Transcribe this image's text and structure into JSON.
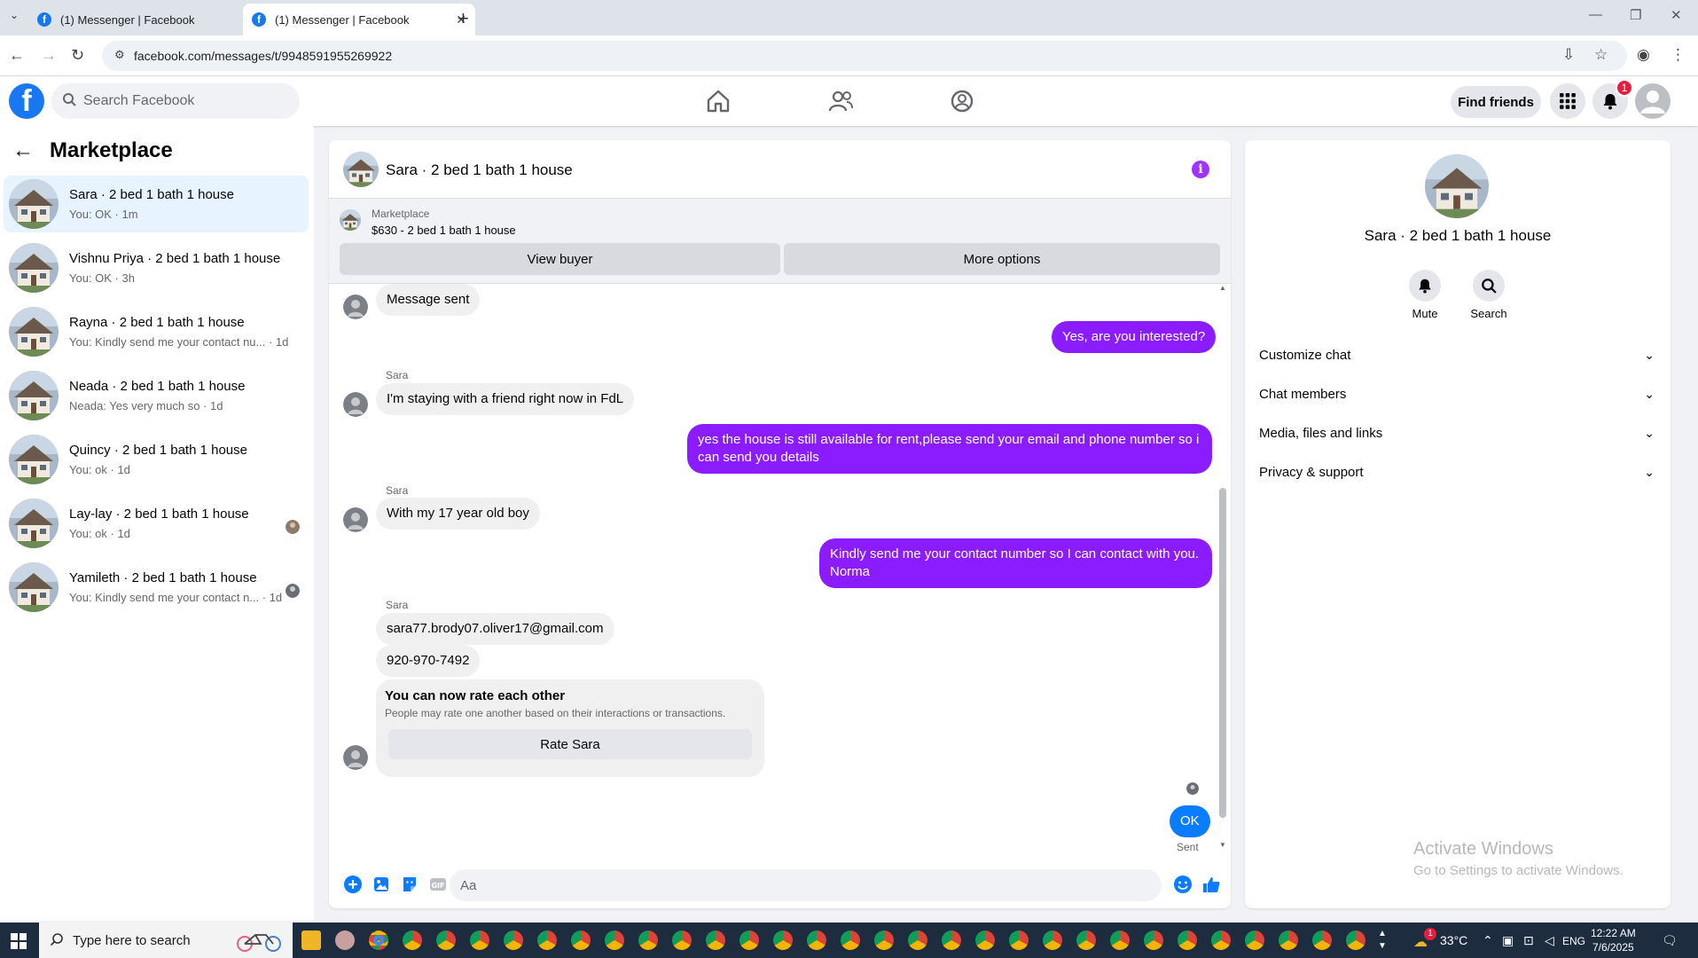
{
  "browser": {
    "tabs": [
      {
        "title": "(1) Messenger | Facebook",
        "active": false
      },
      {
        "title": "(1) Messenger | Facebook",
        "active": true
      }
    ],
    "url": "facebook.com/messages/t/9948591955269922"
  },
  "fb": {
    "search_placeholder": "Search Facebook",
    "find_friends": "Find friends",
    "notif_count": "1"
  },
  "sidebar": {
    "title": "Marketplace",
    "conversations": [
      {
        "name": "Sara · 2 bed 1 bath 1 house",
        "snippet": "You: OK · 1m",
        "active": true
      },
      {
        "name": "Vishnu Priya · 2 bed 1 bath 1 house",
        "snippet": "You: OK · 3h"
      },
      {
        "name": "Rayna · 2 bed 1 bath 1 house",
        "snippet": "You: Kindly send me your contact nu... · 1d"
      },
      {
        "name": "Neada · 2 bed 1 bath 1 house",
        "snippet": "Neada: Yes very much so · 1d"
      },
      {
        "name": "Quincy · 2 bed 1 bath 1 house",
        "snippet": "You: ok · 1d"
      },
      {
        "name": "Lay-lay · 2 bed 1 bath 1 house",
        "snippet": "You: ok · 1d"
      },
      {
        "name": "Yamileth · 2 bed 1 bath 1 house",
        "snippet": "You: Kindly send me your contact n... · 1d"
      }
    ]
  },
  "chat": {
    "title": "Sara · 2 bed 1 bath 1 house",
    "marketplace_label": "Marketplace",
    "listing": "$630 - 2 bed 1 bath 1 house",
    "view_buyer": "View buyer",
    "more_options": "More options",
    "messages": {
      "m1": "Message sent",
      "m2": "Yes, are you interested?",
      "m3_sender": "Sara",
      "m3": "I'm staying with a friend right now in FdL",
      "m4": "yes the house is still available for rent,please send your email and phone number so i can send you details",
      "m5_sender": "Sara",
      "m5": "With my 17 year old boy",
      "m6": "Kindly send me your contact number so I can contact with you. Norma",
      "m7_sender": "Sara",
      "m7": "sara77.brody07.oliver17@gmail.com",
      "m8": "920-970-7492",
      "m9": "OK"
    },
    "rate": {
      "heading": "You can now rate each other",
      "text": "People may rate one another based on their interactions or transactions.",
      "button": "Rate Sara"
    },
    "sent_label": "Sent",
    "composer_placeholder": "Aa"
  },
  "details": {
    "name": "Sara · 2 bed 1 bath 1 house",
    "mute": "Mute",
    "search": "Search",
    "sections": [
      "Customize chat",
      "Chat members",
      "Media, files and links",
      "Privacy & support"
    ]
  },
  "watermark": {
    "line1": "Activate Windows",
    "line2": "Go to Settings to activate Windows."
  },
  "taskbar": {
    "search_placeholder": "Type here to search",
    "weather": "33°C",
    "lang": "ENG",
    "time": "12:22 AM",
    "date": "7/6/2025",
    "notif_count": "1"
  },
  "colors": {
    "fb_blue": "#1877f2",
    "outgoing_bubble": "#8a1cff",
    "ok_bubble": "#0a7cff",
    "active_conv": "#e7f3ff"
  }
}
